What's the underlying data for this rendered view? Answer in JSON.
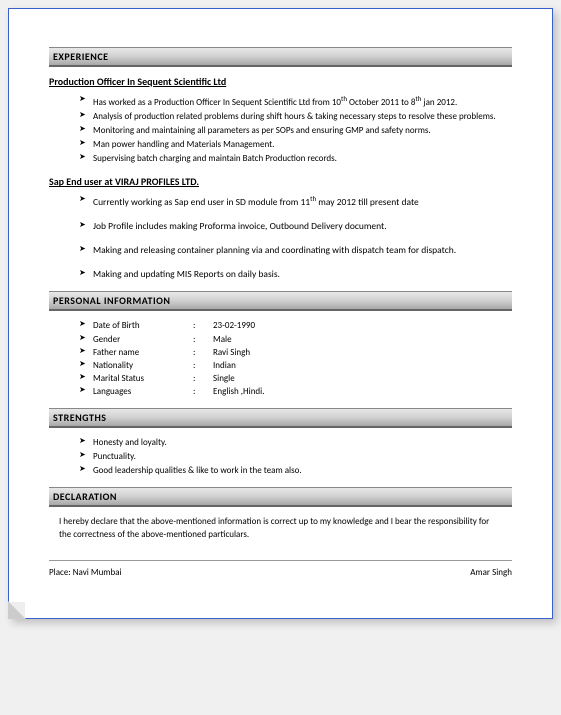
{
  "sections": {
    "experience": "EXPERIENCE",
    "personal": "PERSONAL INFORMATION",
    "strengths": "STRENGTHS",
    "declaration": "DECLARATION"
  },
  "job1": {
    "title": "Production Officer In Sequent Scientific Ltd",
    "b1a": "Has worked as a Production Officer In Sequent Scientific Ltd from 10",
    "b1b": " October 2011 to 8",
    "b1c": " jan 2012.",
    "b1sup1": "th",
    "b1sup2": "th",
    "b2": "Analysis of production related problems during shift hours & taking necessary steps to resolve these problems.",
    "b3": "Monitoring and maintaining all parameters as per SOPs and ensuring  GMP and safety norms.",
    "b4": "Man power handling and Materials Management.",
    "b5": "Supervising batch charging and maintain Batch Production records."
  },
  "job2": {
    "title": "Sap End user at VIRAJ PROFILES LTD.",
    "b1a": "Currently working as Sap end user in SD module from 11",
    "b1sup": "th",
    "b1b": " may 2012 till present date",
    "b2": "Job Profile includes making Proforma invoice, Outbound Delivery document.",
    "b3": "Making and releasing container planning via and coordinating with dispatch team for dispatch.",
    "b4": "Making and updating MIS Reports on daily basis."
  },
  "personal": {
    "dob_l": "Date of Birth",
    "dob_v": "23-02-1990",
    "gender_l": "Gender",
    "gender_v": "Male",
    "father_l": "Father name",
    "father_v": "Ravi Singh",
    "nat_l": "Nationality",
    "nat_v": "Indian",
    "marital_l": "Marital Status",
    "marital_v": "Single",
    "lang_l": "Languages",
    "lang_v": "English ,Hindi."
  },
  "strengths": {
    "s1": "Honesty and loyalty.",
    "s2": "Punctuality.",
    "s3": "Good leadership qualities & like to work in the team also."
  },
  "declaration_text": "I hereby declare that the above-mentioned information is correct up to my knowledge and I bear the responsibility for the correctness of the above-mentioned particulars.",
  "footer": {
    "place": "Place: Navi Mumbai",
    "name": "Amar Singh"
  },
  "sep": ":"
}
